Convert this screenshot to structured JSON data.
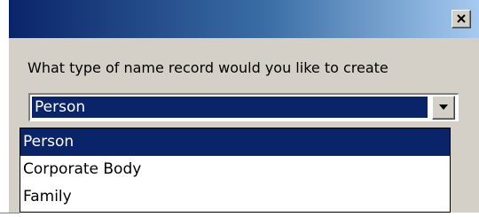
{
  "dialog": {
    "title": "",
    "close_icon": "close-icon",
    "prompt": "What type of name record would you like to create"
  },
  "combo": {
    "selected_value": "Person",
    "dropdown_icon": "chevron-down-icon"
  },
  "dropdown": {
    "options": [
      {
        "label": "Person",
        "selected": true
      },
      {
        "label": "Corporate Body",
        "selected": false
      },
      {
        "label": "Family",
        "selected": false
      }
    ]
  },
  "colors": {
    "titlebar_start": "#0a246a",
    "titlebar_end": "#a6caf0",
    "selection": "#0a246a",
    "dialog_face": "#d4d0c8"
  }
}
